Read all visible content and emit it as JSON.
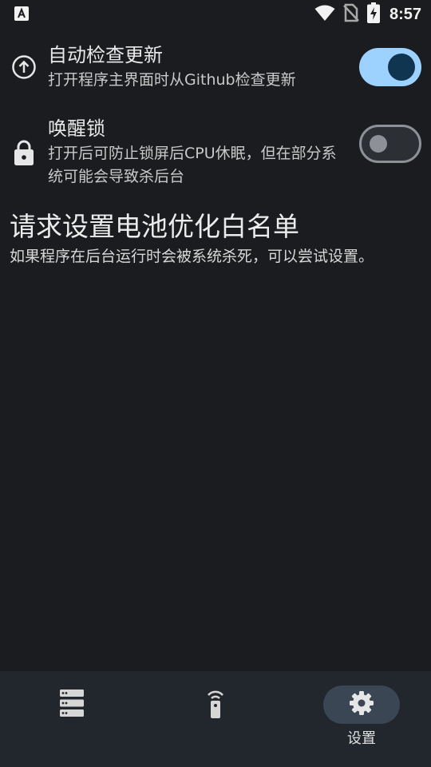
{
  "status_bar": {
    "time": "8:57",
    "icons": [
      "app-notification-icon",
      "wifi-icon",
      "no-sim-icon",
      "battery-charging-icon"
    ]
  },
  "settings": {
    "auto_update": {
      "icon": "arrow-up-circle-icon",
      "title": "自动检查更新",
      "description": "打开程序主界面时从Github检查更新",
      "enabled": true
    },
    "wake_lock": {
      "icon": "lock-icon",
      "title": "唤醒锁",
      "description": "打开后可防止锁屏后CPU休眠，但在部分系统可能会导致杀后台",
      "enabled": false
    },
    "battery_whitelist": {
      "title": "请求设置电池优化白名单",
      "description": "如果程序在后台运行时会被系统杀死，可以尝试设置。"
    }
  },
  "bottom_nav": {
    "items": [
      {
        "icon": "server-list-icon",
        "label": ""
      },
      {
        "icon": "remote-control-icon",
        "label": ""
      },
      {
        "icon": "gear-icon",
        "label": "设置",
        "active": true
      }
    ]
  },
  "colors": {
    "background": "#1b1c1f",
    "switch_on_track": "#9dd2ff",
    "switch_on_knob": "#0f3550",
    "nav_background": "#22272e",
    "nav_active_pill": "#3a4654"
  }
}
